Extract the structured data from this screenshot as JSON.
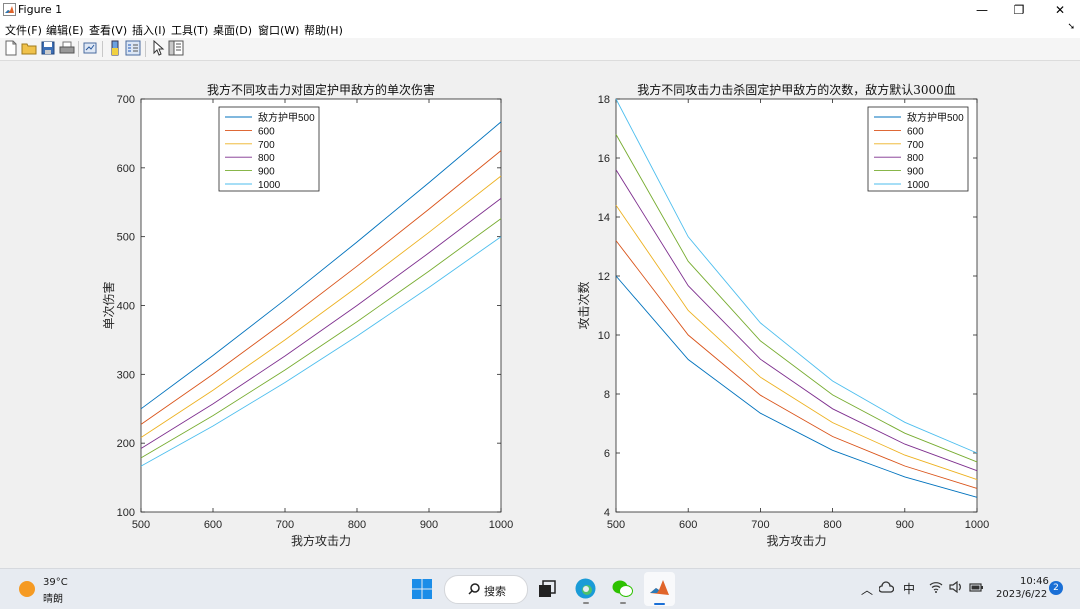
{
  "window": {
    "title": "Figure 1",
    "controls": {
      "minimize": "—",
      "maximize": "❐",
      "close": "✕"
    }
  },
  "menu": [
    "文件(F)",
    "编辑(E)",
    "查看(V)",
    "插入(I)",
    "工具(T)",
    "桌面(D)",
    "窗口(W)",
    "帮助(H)"
  ],
  "toolbar_icons": [
    "new-figure-icon",
    "open-file-icon",
    "save-icon",
    "print-icon",
    "link-plot-icon",
    "insert-colorbar-icon",
    "insert-legend-icon",
    "edit-plot-icon",
    "property-inspector-icon"
  ],
  "colors": {
    "series": [
      "#0072bd",
      "#d95319",
      "#edb120",
      "#7e2f8e",
      "#77ac30",
      "#4dbeee"
    ]
  },
  "chart_data": [
    {
      "type": "line",
      "title": "我方不同攻击力对固定护甲敌方的单次伤害",
      "xlabel": "我方攻击力",
      "ylabel": "单次伤害",
      "xlim": [
        500,
        1000
      ],
      "ylim": [
        100,
        700
      ],
      "xticks": [
        500,
        600,
        700,
        800,
        900,
        1000
      ],
      "yticks": [
        100,
        200,
        300,
        400,
        500,
        600,
        700
      ],
      "legend_position": "top-left",
      "x": [
        500,
        600,
        700,
        800,
        900,
        1000
      ],
      "series": [
        {
          "name": "敌方护甲500",
          "values": [
            250,
            327.3,
            408.3,
            492.3,
            578.6,
            666.7
          ]
        },
        {
          "name": "600",
          "values": [
            227.3,
            300,
            376.9,
            457.1,
            540,
            625
          ]
        },
        {
          "name": "700",
          "values": [
            208.3,
            276.9,
            350,
            426.7,
            506.3,
            588.2
          ]
        },
        {
          "name": "800",
          "values": [
            192.3,
            257.1,
            326.7,
            400,
            476.5,
            555.6
          ]
        },
        {
          "name": "900",
          "values": [
            178.6,
            240,
            306.3,
            376.5,
            450,
            526.3
          ]
        },
        {
          "name": "1000",
          "values": [
            166.7,
            225,
            288.2,
            355.6,
            426.3,
            500
          ]
        }
      ]
    },
    {
      "type": "line",
      "title": "我方不同攻击力击杀固定护甲敌方的次数，敌方默认3000血",
      "xlabel": "我方攻击力",
      "ylabel": "攻击次数",
      "xlim": [
        500,
        1000
      ],
      "ylim": [
        4,
        18
      ],
      "xticks": [
        500,
        600,
        700,
        800,
        900,
        1000
      ],
      "yticks": [
        4,
        6,
        8,
        10,
        12,
        14,
        16,
        18
      ],
      "legend_position": "top-right",
      "x": [
        500,
        600,
        700,
        800,
        900,
        1000
      ],
      "series": [
        {
          "name": "敌方护甲500",
          "values": [
            12,
            9.17,
            7.35,
            6.09,
            5.19,
            4.5
          ]
        },
        {
          "name": "600",
          "values": [
            13.2,
            10,
            7.96,
            6.56,
            5.56,
            4.8
          ]
        },
        {
          "name": "700",
          "values": [
            14.4,
            10.83,
            8.57,
            7.03,
            5.93,
            5.1
          ]
        },
        {
          "name": "800",
          "values": [
            15.6,
            11.67,
            9.18,
            7.5,
            6.3,
            5.4
          ]
        },
        {
          "name": "900",
          "values": [
            16.8,
            12.5,
            9.8,
            7.97,
            6.67,
            5.7
          ]
        },
        {
          "name": "1000",
          "values": [
            18,
            13.33,
            10.41,
            8.44,
            7.04,
            6
          ]
        }
      ]
    }
  ],
  "taskbar": {
    "weather_temp": "39°C",
    "weather_desc": "晴朗",
    "search_label": "搜索",
    "ime": "中",
    "time": "10:46",
    "date": "2023/6/22",
    "notification_count": "2"
  }
}
